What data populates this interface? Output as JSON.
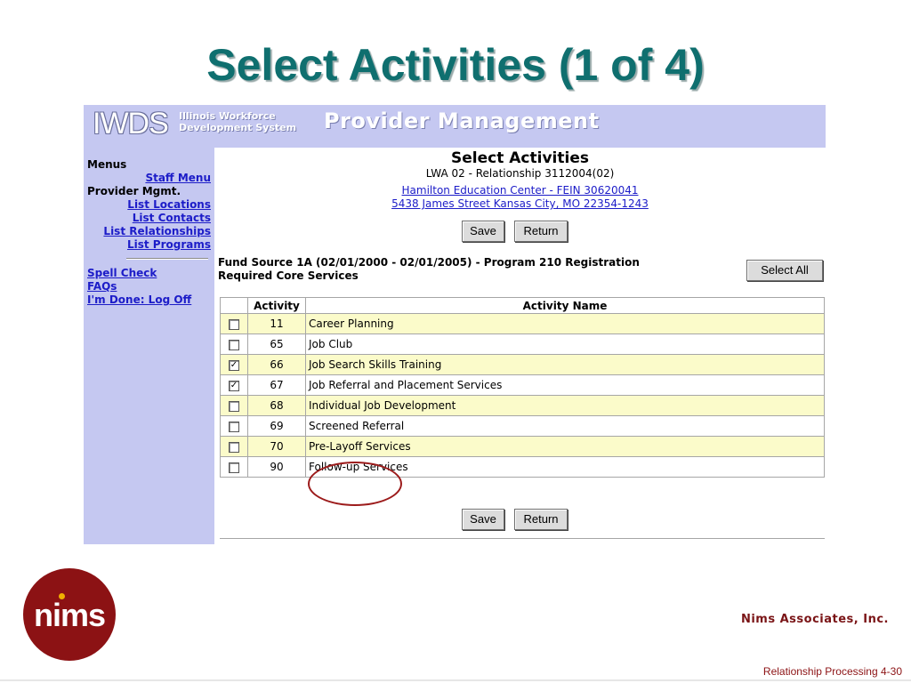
{
  "slide": {
    "title": "Select Activities (1 of 4)",
    "company": "Nims Associates, Inc.",
    "footer": "Relationship Processing  4-30",
    "logo_text": "nims",
    "colors": {
      "title": "#0f6f6f",
      "brand": "#8c1214",
      "banner": "#c5c8f1",
      "row_highlight": "#fbfbca",
      "link": "#1c1cc8"
    }
  },
  "app": {
    "logo": "IWDS",
    "logo_sub_line1": "Illinois Workforce",
    "logo_sub_line2": "Development System",
    "banner_title": "Provider Management"
  },
  "sidebar": {
    "menus_label": "Menus",
    "staff_menu": "Staff Menu",
    "provider_mgmt_label": "Provider Mgmt.",
    "list_locations": "List Locations",
    "list_contacts": "List Contacts",
    "list_relationships": "List Relationships",
    "list_programs": "List Programs",
    "spell_check": "Spell Check",
    "faqs": "FAQs",
    "log_off": "I'm Done: Log Off"
  },
  "page": {
    "title": "Select Activities",
    "relationship": "LWA 02 - Relationship 3112004(02)",
    "provider_link": "Hamilton Education Center - FEIN 30620041",
    "address_link": "5438 James Street Kansas City, MO 22354-1243",
    "save_label": "Save",
    "return_label": "Return",
    "select_all_label": "Select All",
    "fund_line1": "Fund Source 1A  (02/01/2000 - 02/01/2005) - Program  210  Registration",
    "fund_line2": "Required Core Services"
  },
  "table": {
    "col_activity": "Activity",
    "col_name": "Activity Name",
    "rows": [
      {
        "code": "11",
        "name": "Career Planning",
        "checked": false
      },
      {
        "code": "65",
        "name": "Job Club",
        "checked": false
      },
      {
        "code": "66",
        "name": "Job Search Skills Training",
        "checked": true
      },
      {
        "code": "67",
        "name": "Job Referral and Placement Services",
        "checked": true
      },
      {
        "code": "68",
        "name": "Individual Job Development",
        "checked": false
      },
      {
        "code": "69",
        "name": "Screened Referral",
        "checked": false
      },
      {
        "code": "70",
        "name": "Pre-Layoff Services",
        "checked": false
      },
      {
        "code": "90",
        "name": "Follow-up Services",
        "checked": false
      }
    ]
  }
}
